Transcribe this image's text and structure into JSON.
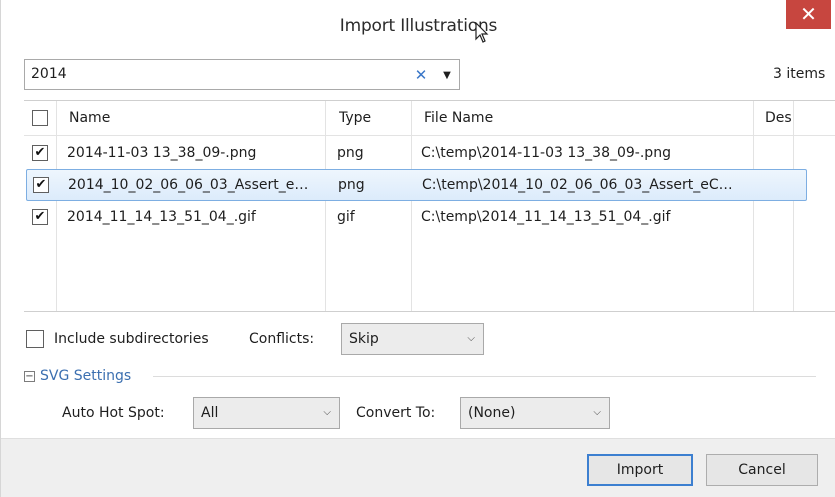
{
  "window": {
    "title": "Import Illustrations",
    "close_glyph": "✕"
  },
  "search": {
    "value": "2014",
    "clear_glyph": "✕",
    "dropdown_glyph": "▼",
    "items_count": "3 items"
  },
  "table": {
    "columns": [
      "Name",
      "Type",
      "File Name",
      "Des"
    ],
    "rows": [
      {
        "checked": "✔",
        "name": "2014-11-03 13_38_09-.png",
        "type": "png",
        "file_name": "C:\\temp\\2014-11-03 13_38_09-.png"
      },
      {
        "checked": "✔",
        "name": "2014_10_02_06_06_03_Assert_e…",
        "type": "png",
        "file_name": "C:\\temp\\2014_10_02_06_06_03_Assert_eC…"
      },
      {
        "checked": "✔",
        "name": "2014_11_14_13_51_04_.gif",
        "type": "gif",
        "file_name": "C:\\temp\\2014_11_14_13_51_04_.gif"
      }
    ]
  },
  "options": {
    "include_subdirectories_label": "Include subdirectories",
    "conflicts_label": "Conflicts:",
    "conflicts_value": "Skip"
  },
  "svg_settings": {
    "header": "SVG Settings",
    "toggle_glyph": "−",
    "auto_hot_spot_label": "Auto Hot Spot:",
    "auto_hot_spot_value": "All",
    "convert_to_label": "Convert To:",
    "convert_to_value": "(None)"
  },
  "buttons": {
    "import": "Import",
    "cancel": "Cancel"
  },
  "icons": {
    "chevron": "⌄"
  },
  "colors": {
    "close_red": "#c7463f",
    "accent_blue": "#3c7fd0",
    "selection": "#dcebfb"
  }
}
